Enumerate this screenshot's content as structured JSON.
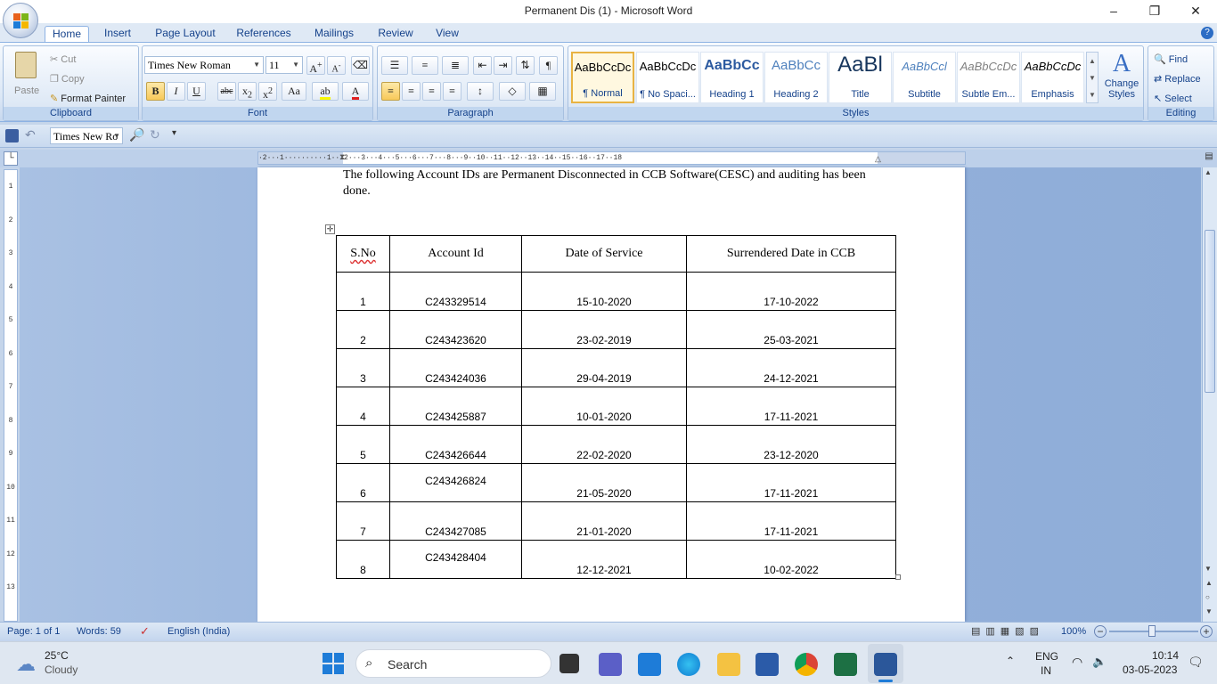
{
  "window": {
    "title": "Permanent Dis (1) - Microsoft Word"
  },
  "tabs": [
    "Home",
    "Insert",
    "Page Layout",
    "References",
    "Mailings",
    "Review",
    "View"
  ],
  "clipboard": {
    "paste": "Paste",
    "cut": "Cut",
    "copy": "Copy",
    "format_painter": "Format Painter",
    "label": "Clipboard"
  },
  "font": {
    "name": "Times New Roman",
    "size": "11",
    "label": "Font"
  },
  "paragraph": {
    "label": "Paragraph"
  },
  "styles": {
    "label": "Styles",
    "items": [
      {
        "sample": "AaBbCcDc",
        "name": "¶ Normal"
      },
      {
        "sample": "AaBbCcDc",
        "name": "¶ No Spaci..."
      },
      {
        "sample": "AaBbCc",
        "name": "Heading 1"
      },
      {
        "sample": "AaBbCc",
        "name": "Heading 2"
      },
      {
        "sample": "AaBl",
        "name": "Title"
      },
      {
        "sample": "AaBbCcl",
        "name": "Subtitle"
      },
      {
        "sample": "AaBbCcDc",
        "name": "Subtle Em..."
      },
      {
        "sample": "AaBbCcDc",
        "name": "Emphasis"
      }
    ],
    "change_styles": "Change Styles"
  },
  "editing": {
    "find": "Find",
    "replace": "Replace",
    "select": "Select",
    "label": "Editing"
  },
  "qat": {
    "font": "Times New Ro"
  },
  "document": {
    "intro": "The following Account IDs are Permanent Disconnected in CCB Software(CESC) and auditing has been done.",
    "headers": [
      "S.No",
      "Account Id",
      "Date of Service",
      "Surrendered Date in CCB"
    ],
    "rows": [
      [
        "1",
        "C243329514",
        "15-10-2020",
        "17-10-2022"
      ],
      [
        "2",
        "C243423620",
        "23-02-2019",
        "25-03-2021"
      ],
      [
        "3",
        "C243424036",
        "29-04-2019",
        "24-12-2021"
      ],
      [
        "4",
        "C243425887",
        "10-01-2020",
        "17-11-2021"
      ],
      [
        "5",
        "C243426644",
        "22-02-2020",
        "23-12-2020"
      ],
      [
        "6",
        "C243426824",
        "21-05-2020",
        "17-11-2021"
      ],
      [
        "7",
        "C243427085",
        "21-01-2020",
        "17-11-2021"
      ],
      [
        "8",
        "C243428404",
        "12-12-2021",
        "10-02-2022"
      ]
    ]
  },
  "status": {
    "page": "Page: 1 of 1",
    "words": "Words: 59",
    "language": "English (India)",
    "zoom": "100%"
  },
  "taskbar": {
    "temp": "25°C",
    "weather": "Cloudy",
    "search": "Search",
    "lang1": "ENG",
    "lang2": "IN",
    "time": "10:14",
    "date": "03-05-2023"
  }
}
